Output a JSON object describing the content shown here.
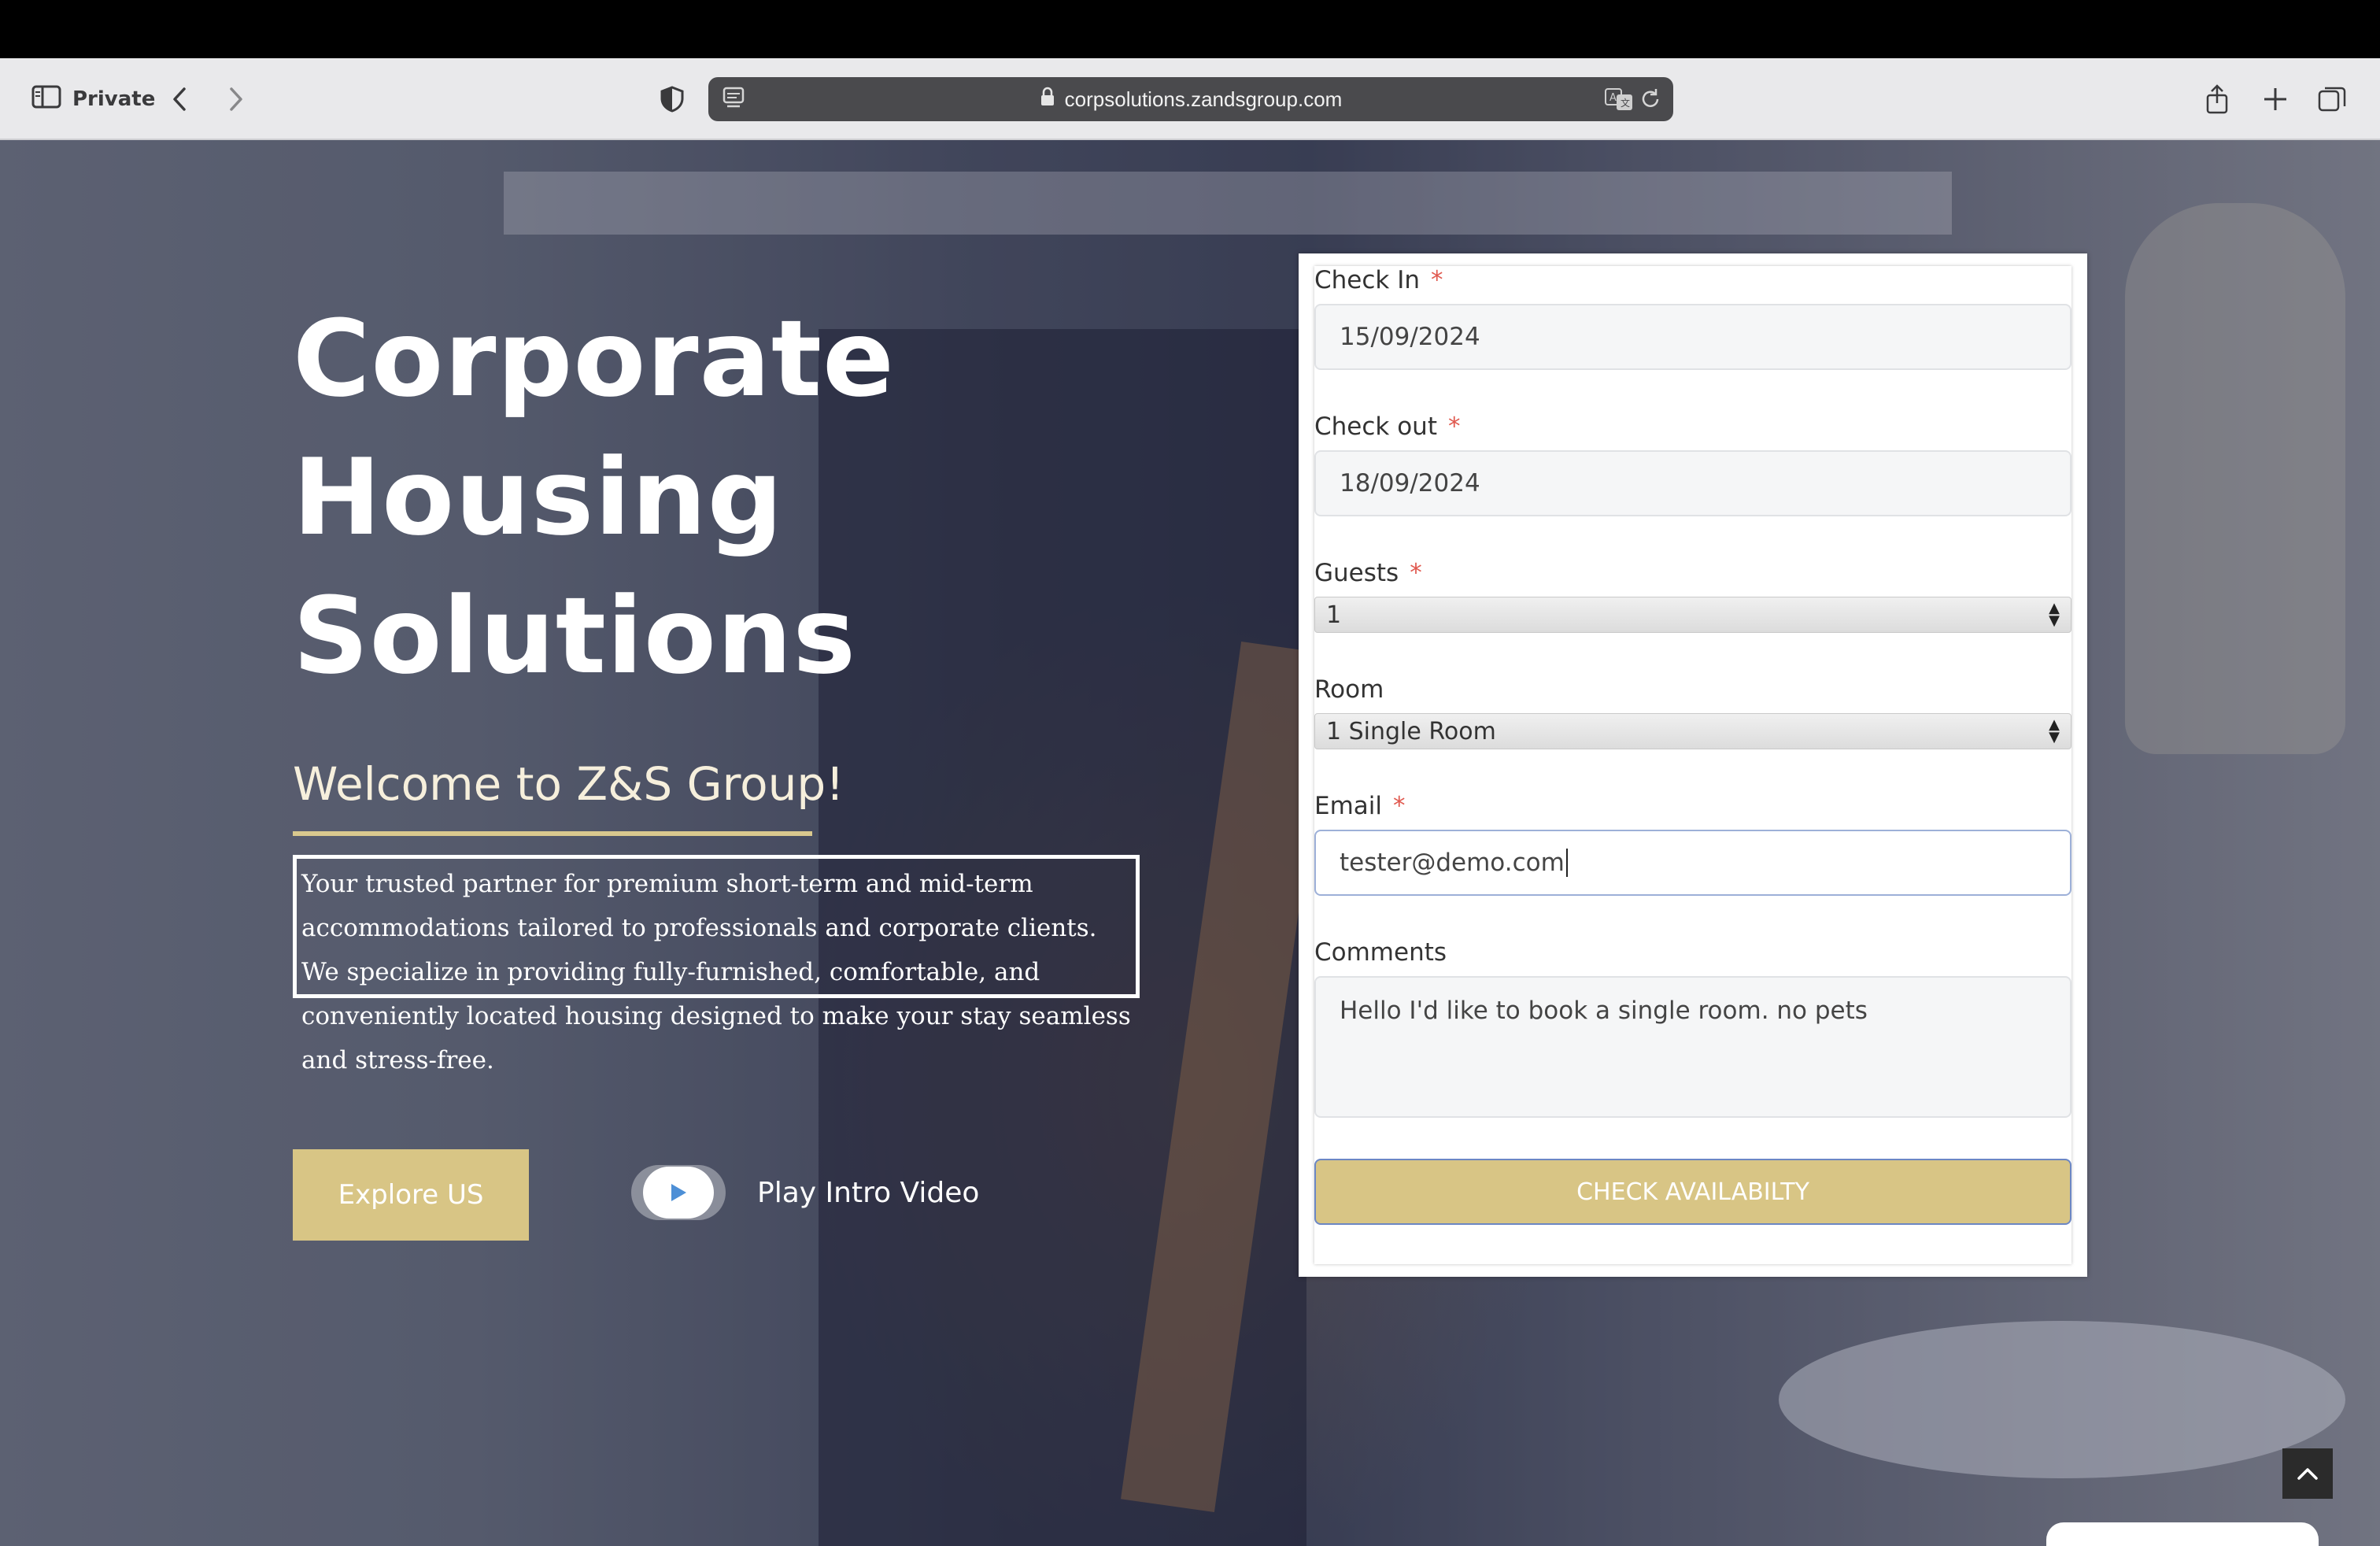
{
  "browser": {
    "private_label": "Private",
    "url": "corpsolutions.zandsgroup.com"
  },
  "hero": {
    "title_line1": "Corporate",
    "title_line2": "Housing",
    "title_line3": "Solutions",
    "welcome": "Welcome to Z&S Group!",
    "intro": "Your trusted partner for premium short-term and mid-term accommodations tailored to professionals and corporate clients. We specialize in providing fully-furnished, comfortable, and conveniently located housing designed to make your stay seamless and stress-free.",
    "explore_label": "Explore US",
    "play_label": "Play Intro Video"
  },
  "form": {
    "checkin_label": "Check In",
    "checkin_value": "15/09/2024",
    "checkout_label": "Check out",
    "checkout_value": "18/09/2024",
    "guests_label": "Guests",
    "guests_value": "1",
    "room_label": "Room",
    "room_value": "1 Single Room",
    "email_label": "Email",
    "email_value": "tester@demo.com",
    "comments_label": "Comments",
    "comments_value": "Hello I'd like to book a single room. no pets",
    "required_mark": "*",
    "submit_label": "CHECK AVAILABILTY"
  },
  "colors": {
    "accent_gold": "#d8c585",
    "required_red": "#e0594f",
    "focus_blue": "#9db0d8"
  }
}
